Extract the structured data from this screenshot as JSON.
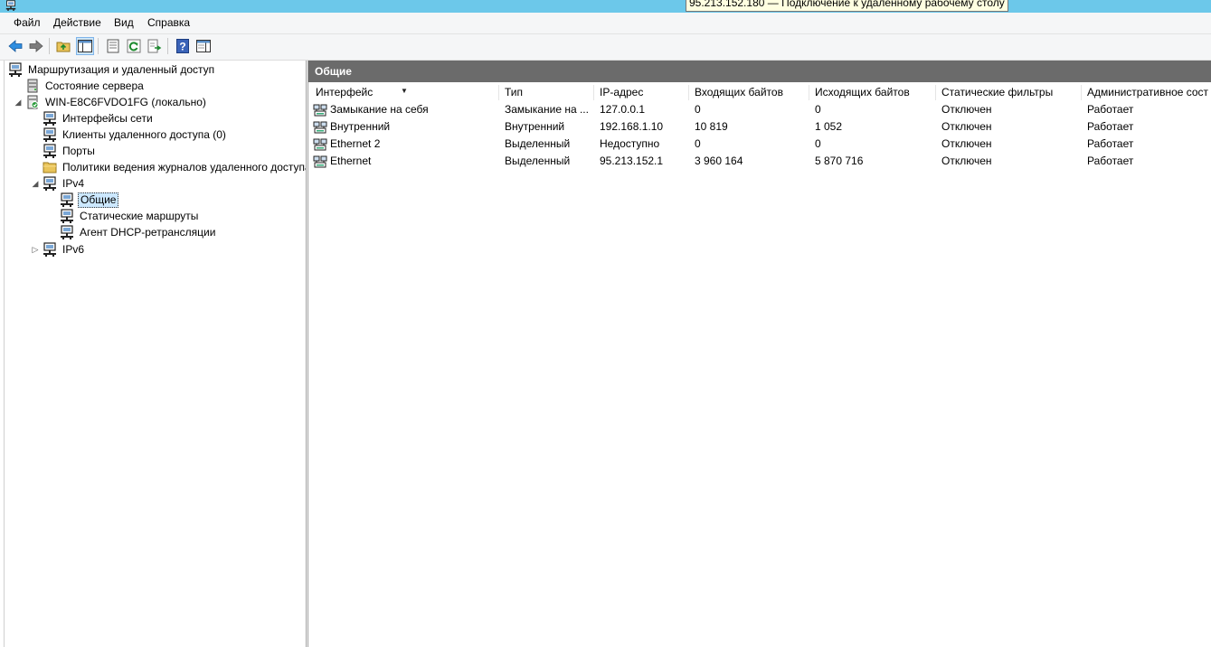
{
  "window": {
    "tooltip": "95.213.152.180 — Подключение к удаленному рабочему столу",
    "app_icon": "server-icon"
  },
  "menu": {
    "items": [
      "Файл",
      "Действие",
      "Вид",
      "Справка"
    ]
  },
  "toolbar": {
    "buttons": [
      "back-icon",
      "forward-icon",
      "up-folder-icon",
      "show-hide-tree-icon",
      "properties-icon",
      "refresh-icon",
      "export-list-icon",
      "help-icon",
      "action-pane-icon"
    ]
  },
  "tree": {
    "root": "Маршрутизация и удаленный доступ",
    "server_status": "Состояние сервера",
    "server": "WIN-E8C6FVDO1FG (локально)",
    "interfaces": "Интерфейсы сети",
    "remote_clients": "Клиенты удаленного доступа (0)",
    "ports": "Порты",
    "logging": "Политики ведения журналов удаленного доступа",
    "ipv4": "IPv4",
    "general": "Общие",
    "static_routes": "Статические маршруты",
    "dhcp_relay": "Агент DHCP-ретрансляции",
    "ipv6": "IPv6"
  },
  "details": {
    "title": "Общие",
    "columns": [
      "Интерфейс",
      "Тип",
      "IP-адрес",
      "Входящих байтов",
      "Исходящих байтов",
      "Статические фильтры",
      "Административное сост"
    ],
    "rows": [
      {
        "interface": "Замыкание на себя",
        "type": "Замыкание на ...",
        "ip": "127.0.0.1",
        "in": "0",
        "out": "0",
        "filters": "Отключен",
        "admin": "Работает"
      },
      {
        "interface": "Внутренний",
        "type": "Внутренний",
        "ip": "192.168.1.10",
        "in": "10 819",
        "out": "1 052",
        "filters": "Отключен",
        "admin": "Работает"
      },
      {
        "interface": "Ethernet 2",
        "type": "Выделенный",
        "ip": "Недоступно",
        "in": "0",
        "out": "0",
        "filters": "Отключен",
        "admin": "Работает"
      },
      {
        "interface": "Ethernet",
        "type": "Выделенный",
        "ip": "95.213.152.1",
        "in": "3 960 164",
        "out": "5 870 716",
        "filters": "Отключен",
        "admin": "Работает"
      }
    ]
  }
}
